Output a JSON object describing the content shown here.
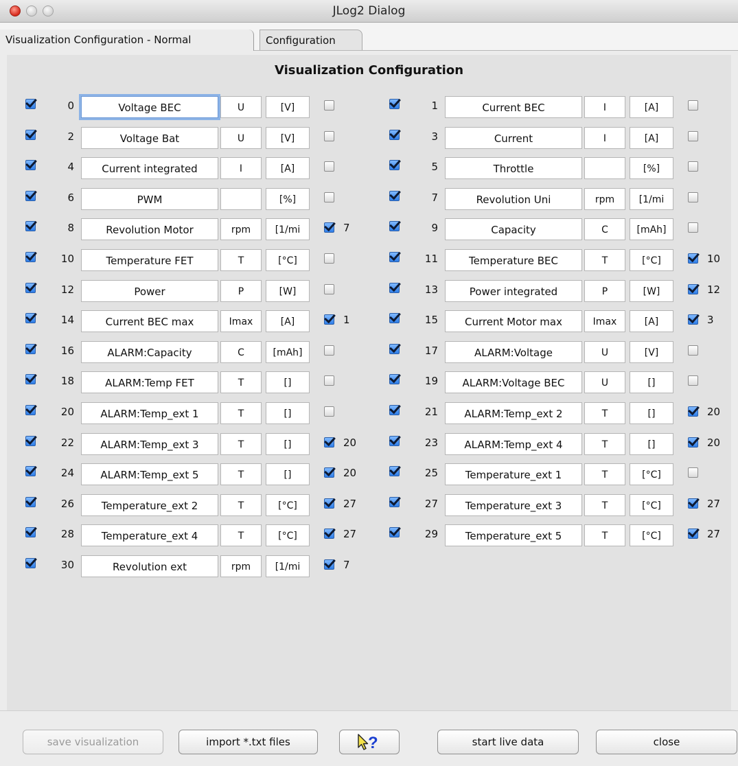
{
  "window": {
    "title": "JLog2 Dialog"
  },
  "tabs": [
    {
      "label": "Visualization Configuration - Normal",
      "active": true
    },
    {
      "label": "Configuration",
      "active": false
    }
  ],
  "heading": "Visualization Configuration",
  "rows": [
    {
      "enabled": true,
      "index": "0",
      "name": "Voltage BEC",
      "symbol": "U",
      "unit": "[V]",
      "ref_checked": false,
      "ref": ""
    },
    {
      "enabled": true,
      "index": "1",
      "name": "Current BEC",
      "symbol": "I",
      "unit": "[A]",
      "ref_checked": false,
      "ref": ""
    },
    {
      "enabled": true,
      "index": "2",
      "name": "Voltage Bat",
      "symbol": "U",
      "unit": "[V]",
      "ref_checked": false,
      "ref": ""
    },
    {
      "enabled": true,
      "index": "3",
      "name": "Current",
      "symbol": "I",
      "unit": "[A]",
      "ref_checked": false,
      "ref": ""
    },
    {
      "enabled": true,
      "index": "4",
      "name": "Current integrated",
      "symbol": "I",
      "unit": "[A]",
      "ref_checked": false,
      "ref": ""
    },
    {
      "enabled": true,
      "index": "5",
      "name": "Throttle",
      "symbol": "",
      "unit": "[%]",
      "ref_checked": false,
      "ref": ""
    },
    {
      "enabled": true,
      "index": "6",
      "name": "PWM",
      "symbol": "",
      "unit": "[%]",
      "ref_checked": false,
      "ref": ""
    },
    {
      "enabled": true,
      "index": "7",
      "name": "Revolution Uni",
      "symbol": "rpm",
      "unit": "[1/mi",
      "ref_checked": false,
      "ref": ""
    },
    {
      "enabled": true,
      "index": "8",
      "name": "Revolution Motor",
      "symbol": "rpm",
      "unit": "[1/mi",
      "ref_checked": true,
      "ref": "7"
    },
    {
      "enabled": true,
      "index": "9",
      "name": "Capacity",
      "symbol": "C",
      "unit": "[mAh]",
      "ref_checked": false,
      "ref": ""
    },
    {
      "enabled": true,
      "index": "10",
      "name": "Temperature FET",
      "symbol": "T",
      "unit": "[°C]",
      "ref_checked": false,
      "ref": ""
    },
    {
      "enabled": true,
      "index": "11",
      "name": "Temperature BEC",
      "symbol": "T",
      "unit": "[°C]",
      "ref_checked": true,
      "ref": "10"
    },
    {
      "enabled": true,
      "index": "12",
      "name": "Power",
      "symbol": "P",
      "unit": "[W]",
      "ref_checked": false,
      "ref": ""
    },
    {
      "enabled": true,
      "index": "13",
      "name": "Power integrated",
      "symbol": "P",
      "unit": "[W]",
      "ref_checked": true,
      "ref": "12"
    },
    {
      "enabled": true,
      "index": "14",
      "name": "Current BEC max",
      "symbol": "Imax",
      "unit": "[A]",
      "ref_checked": true,
      "ref": "1"
    },
    {
      "enabled": true,
      "index": "15",
      "name": "Current Motor max",
      "symbol": "Imax",
      "unit": "[A]",
      "ref_checked": true,
      "ref": "3"
    },
    {
      "enabled": true,
      "index": "16",
      "name": "ALARM:Capacity",
      "symbol": "C",
      "unit": "[mAh]",
      "ref_checked": false,
      "ref": ""
    },
    {
      "enabled": true,
      "index": "17",
      "name": "ALARM:Voltage",
      "symbol": "U",
      "unit": "[V]",
      "ref_checked": false,
      "ref": ""
    },
    {
      "enabled": true,
      "index": "18",
      "name": "ALARM:Temp FET",
      "symbol": "T",
      "unit": "[]",
      "ref_checked": false,
      "ref": ""
    },
    {
      "enabled": true,
      "index": "19",
      "name": "ALARM:Voltage BEC",
      "symbol": "U",
      "unit": "[]",
      "ref_checked": false,
      "ref": ""
    },
    {
      "enabled": true,
      "index": "20",
      "name": "ALARM:Temp_ext 1",
      "symbol": "T",
      "unit": "[]",
      "ref_checked": false,
      "ref": ""
    },
    {
      "enabled": true,
      "index": "21",
      "name": "ALARM:Temp_ext 2",
      "symbol": "T",
      "unit": "[]",
      "ref_checked": true,
      "ref": "20"
    },
    {
      "enabled": true,
      "index": "22",
      "name": "ALARM:Temp_ext 3",
      "symbol": "T",
      "unit": "[]",
      "ref_checked": true,
      "ref": "20"
    },
    {
      "enabled": true,
      "index": "23",
      "name": "ALARM:Temp_ext 4",
      "symbol": "T",
      "unit": "[]",
      "ref_checked": true,
      "ref": "20"
    },
    {
      "enabled": true,
      "index": "24",
      "name": "ALARM:Temp_ext 5",
      "symbol": "T",
      "unit": "[]",
      "ref_checked": true,
      "ref": "20"
    },
    {
      "enabled": true,
      "index": "25",
      "name": "Temperature_ext 1",
      "symbol": "T",
      "unit": "[°C]",
      "ref_checked": false,
      "ref": ""
    },
    {
      "enabled": true,
      "index": "26",
      "name": "Temperature_ext 2",
      "symbol": "T",
      "unit": "[°C]",
      "ref_checked": true,
      "ref": "27"
    },
    {
      "enabled": true,
      "index": "27",
      "name": "Temperature_ext 3",
      "symbol": "T",
      "unit": "[°C]",
      "ref_checked": true,
      "ref": "27"
    },
    {
      "enabled": true,
      "index": "28",
      "name": "Temperature_ext 4",
      "symbol": "T",
      "unit": "[°C]",
      "ref_checked": true,
      "ref": "27"
    },
    {
      "enabled": true,
      "index": "29",
      "name": "Temperature_ext 5",
      "symbol": "T",
      "unit": "[°C]",
      "ref_checked": true,
      "ref": "27"
    },
    {
      "enabled": true,
      "index": "30",
      "name": "Revolution ext",
      "symbol": "rpm",
      "unit": "[1/mi",
      "ref_checked": true,
      "ref": "7"
    }
  ],
  "buttons": {
    "save": "save visualization",
    "import": "import *.txt files",
    "help_icon": "pointer-question-icon",
    "start": "start live data",
    "close": "close"
  }
}
